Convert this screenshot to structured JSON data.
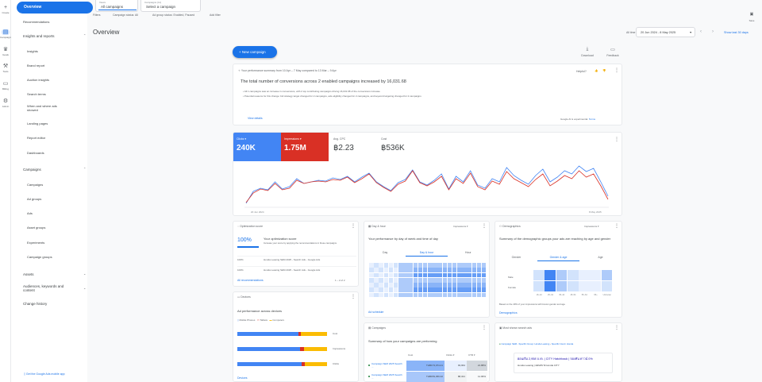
{
  "rail": {
    "items": [
      {
        "icon": "+",
        "label": "Create"
      },
      {
        "icon": "▤",
        "label": "Campaigns"
      },
      {
        "icon": "🏆",
        "label": "Goals"
      },
      {
        "icon": "🔧",
        "label": "Tools"
      },
      {
        "icon": "▭",
        "label": "Billing"
      },
      {
        "icon": "⚙",
        "label": "Admin"
      }
    ]
  },
  "nav": {
    "overview": "Overview",
    "items": [
      {
        "label": "Recommendations",
        "type": "item"
      },
      {
        "label": "Insights and reports",
        "type": "section"
      },
      {
        "label": "Insights",
        "type": "item"
      },
      {
        "label": "Brand report",
        "type": "item"
      },
      {
        "label": "Auction insights",
        "type": "item"
      },
      {
        "label": "Search terms",
        "type": "item"
      },
      {
        "label": "When and where ads",
        "label2": "showed",
        "type": "item"
      },
      {
        "label": "Landing pages",
        "type": "item"
      },
      {
        "label": "Report editor",
        "type": "item"
      },
      {
        "label": "Dashboards",
        "type": "item"
      },
      {
        "label": "Campaigns",
        "type": "section"
      },
      {
        "label": "Campaigns",
        "type": "item"
      },
      {
        "label": "Ad groups",
        "type": "item"
      },
      {
        "label": "Ads",
        "type": "item"
      },
      {
        "label": "Asset groups",
        "type": "item"
      },
      {
        "label": "Experiments",
        "type": "item"
      },
      {
        "label": "Campaign groups",
        "type": "item"
      },
      {
        "label": "Assets",
        "type": "section"
      },
      {
        "label": "Audiences, keywords and",
        "label2": "content",
        "type": "section"
      },
      {
        "label": "Change history",
        "type": "section"
      }
    ],
    "app_link": "Get the Google Ads mobile app"
  },
  "topbar": {
    "filter1_small": "Views",
    "filter1_main": "All campaigns",
    "filter2_small": "Campaigns (11)",
    "filter2_main": "Select a campaign",
    "filters_label": "Filters",
    "filter_status": "Campaign status: All",
    "filter_adgroup": "Ad group status: Enabled, Paused",
    "add_filter": "Add filter",
    "save_label": "Save"
  },
  "page": {
    "title": "Overview",
    "date_label": "All time",
    "date_range": "20 Jun 2024 - 8 May 2025",
    "show_last": "Show last 30 days",
    "new_campaign": "New campaign",
    "download": "Download",
    "feedback": "Feedback"
  },
  "summary": {
    "header": "Your performance summary from 10 Apr – 7 May compared to 13 Mar – 9 Apr",
    "helpful": "Helpful?",
    "headline": "The total number of conversions across 2 enabled campaigns increased by 16,031.68",
    "bullet1": "All 1 campaigns saw an increase in conversions, with 2 top contributing campaigns driving 16,031.68 of the conversions increase",
    "bullet2": "Potential reasons for this change: bid strategy target changed for 2 campaigns, ads eligibility changed for 2 campaigns, and keyword targeting changed for 2 campaigns",
    "view_details": "View details",
    "ai_note": "Google AI is experimental.",
    "ai_link": "Terms"
  },
  "metrics": [
    {
      "label": "Clicks",
      "value": "240K",
      "bg": "#4285f4",
      "fg": "#ffffff"
    },
    {
      "label": "Impressions",
      "value": "1.75M",
      "bg": "#d93025",
      "fg": "#ffffff"
    },
    {
      "label": "Avg. CPC",
      "value": "฿2.23",
      "bg": "#ffffff",
      "fg": "#3c4043"
    },
    {
      "label": "Cost",
      "value": "฿536K",
      "bg": "#ffffff",
      "fg": "#3c4043"
    }
  ],
  "chart_data": {
    "type": "line",
    "x_labels": [
      "20 Jun 2024",
      "8 May 2025"
    ],
    "y_left_ticks": [
      "",
      ""
    ],
    "y_right_ticks": [
      "",
      ""
    ],
    "series": [
      {
        "name": "Clicks",
        "color": "#4285f4",
        "values": [
          3,
          18,
          22,
          20,
          30,
          21,
          24,
          34,
          28,
          30,
          32,
          31,
          35,
          33,
          37,
          30,
          36,
          41,
          30,
          24,
          19,
          29,
          33,
          45,
          30,
          26,
          32,
          40,
          21,
          37,
          30,
          44,
          26,
          22,
          34,
          30,
          48,
          38,
          32,
          27,
          38,
          46,
          30,
          36,
          44,
          40,
          50,
          43,
          47,
          30,
          12
        ]
      },
      {
        "name": "Impressions",
        "color": "#d93025",
        "values": [
          4,
          16,
          21,
          19,
          28,
          20,
          22,
          32,
          28,
          30,
          31,
          30,
          33,
          32,
          36,
          29,
          34,
          40,
          29,
          23,
          18,
          27,
          31,
          44,
          29,
          25,
          30,
          37,
          20,
          34,
          28,
          41,
          24,
          20,
          31,
          27,
          43,
          34,
          29,
          24,
          33,
          40,
          25,
          31,
          38,
          34,
          44,
          36,
          40,
          25,
          8
        ]
      }
    ]
  },
  "optimization": {
    "title": "Optimization score",
    "score": "100%",
    "score_label": "Your optimization score",
    "score_desc": "Increase your score by applying the recommendations in these campaigns",
    "rows": [
      {
        "pct": "100%",
        "name": "Honda Leasing SEM 2025 - Search Ads - Google Ads"
      },
      {
        "pct": "100%",
        "name": "Honda Leasing SEM 2025 - Search Ads - Google Ads"
      }
    ],
    "link": "All recommendations",
    "pager": "1 – 2 of 2"
  },
  "devices": {
    "title": "Devices",
    "subtitle": "Ad performance across devices",
    "legend": [
      "Mobile Phones",
      "Tablets",
      "Computers"
    ],
    "metrics": [
      "Cost",
      "Impressions",
      "Clicks"
    ],
    "link": "Devices"
  },
  "dayhour": {
    "title": "Day & hour",
    "metric": "Impressions",
    "subtitle": "Your performance by day of week and time of day",
    "tabs": [
      "Day",
      "Day & hour",
      "Hour"
    ],
    "link": "Ad schedule"
  },
  "campaigns_card": {
    "title": "Campaigns",
    "subtitle": "Summary of how your campaigns are performing",
    "col1": "Cost",
    "col2": "Clicks",
    "col3": "CTR",
    "rows": [
      {
        "name": "Campaign SEM 2025 Search ...",
        "cost": "THB173,074.41",
        "clicks": "93,964",
        "ctr": "21.88%"
      },
      {
        "name": "Campaign SEM 2025 Search ...",
        "cost": "THB159,459.32",
        "clicks": "88,321",
        "ctr": "11.96%"
      }
    ]
  },
  "demographics": {
    "title": "Demographics",
    "metric": "Impressions",
    "subtitle": "Summary of the demographic groups your ads are reaching by age and gender",
    "tabs": [
      "Gender",
      "Gender & age",
      "Age"
    ],
    "rows": [
      "Male",
      "Female"
    ],
    "ages": [
      "18–24",
      "25–34",
      "35–44",
      "45–54",
      "55–64",
      "65+",
      "Unknown"
    ],
    "note": "Based on the 49% of your impressions with known gender and age",
    "link": "Demographics"
  },
  "searches": {
    "title": "Most shown search ads",
    "campaign": "Campaign SEM - Specific Group: Honda Leasing",
    "adgroup": "Specific Intent: Honda",
    "ad_headline": "ผ่อนเริ่ม 2,958 บ./ด. | CITY Hatchback | จองทัน ดาวน์ 0%",
    "ad_line2": "Honda Leasing | ผ่อนสบาย Honda CITY"
  }
}
